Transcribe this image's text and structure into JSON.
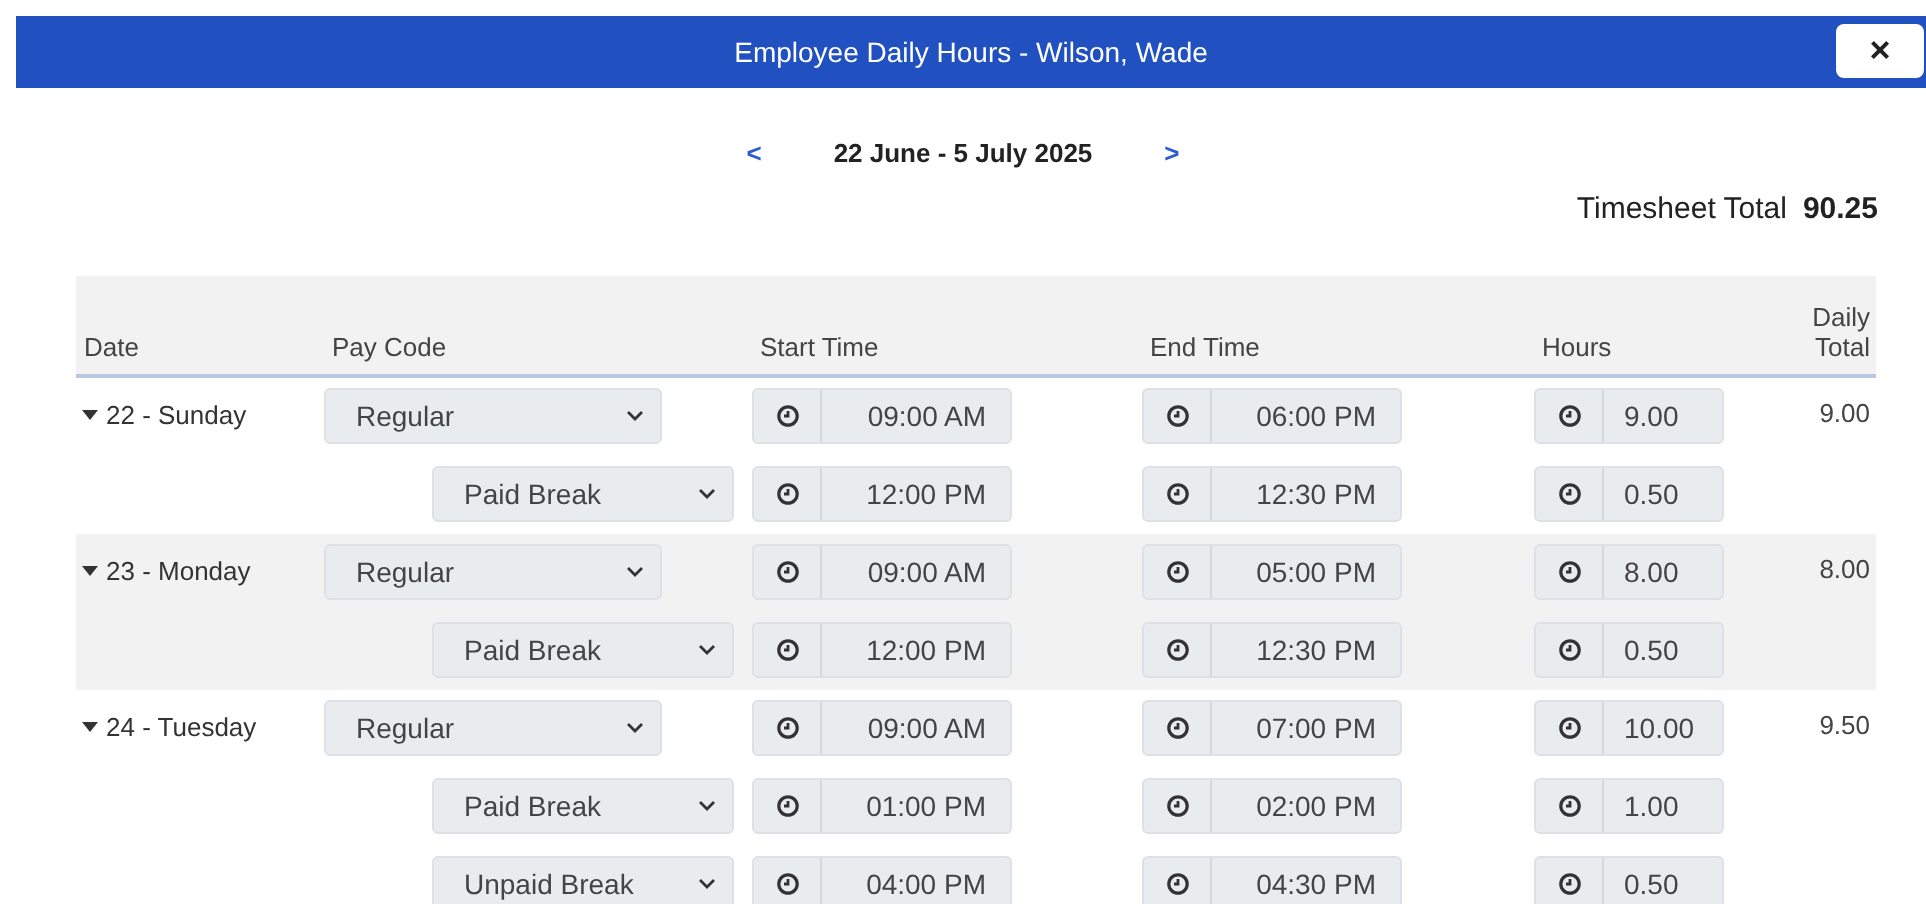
{
  "window": {
    "title": "Employee Daily Hours - Wilson, Wade",
    "close": "×"
  },
  "period": {
    "prev": "<",
    "label": "22 June - 5 July 2025",
    "next": ">"
  },
  "total": {
    "label": "Timesheet Total",
    "value": "90.25"
  },
  "table": {
    "columns": [
      "Date",
      "Pay Code",
      "Start Time",
      "End Time",
      "Hours",
      "Daily Total"
    ],
    "days": [
      {
        "label": "22 - Sunday",
        "expanded": true,
        "daily_total": "9.00",
        "entries": [
          {
            "kind": "shift",
            "pay_code": "Regular",
            "start": "09:00 AM",
            "end": "06:00 PM",
            "hours": "9.00"
          },
          {
            "kind": "break",
            "pay_code": "Paid Break",
            "start": "12:00 PM",
            "end": "12:30 PM",
            "hours": "0.50"
          }
        ]
      },
      {
        "label": "23 - Monday",
        "expanded": true,
        "daily_total": "8.00",
        "entries": [
          {
            "kind": "shift",
            "pay_code": "Regular",
            "start": "09:00 AM",
            "end": "05:00 PM",
            "hours": "8.00"
          },
          {
            "kind": "break",
            "pay_code": "Paid Break",
            "start": "12:00 PM",
            "end": "12:30 PM",
            "hours": "0.50"
          }
        ]
      },
      {
        "label": "24 - Tuesday",
        "expanded": true,
        "daily_total": "9.50",
        "entries": [
          {
            "kind": "shift",
            "pay_code": "Regular",
            "start": "09:00 AM",
            "end": "07:00 PM",
            "hours": "10.00"
          },
          {
            "kind": "break",
            "pay_code": "Paid Break",
            "start": "01:00 PM",
            "end": "02:00 PM",
            "hours": "1.00"
          },
          {
            "kind": "break",
            "pay_code": "Unpaid Break",
            "start": "04:00 PM",
            "end": "04:30 PM",
            "hours": "0.50"
          }
        ]
      }
    ]
  }
}
